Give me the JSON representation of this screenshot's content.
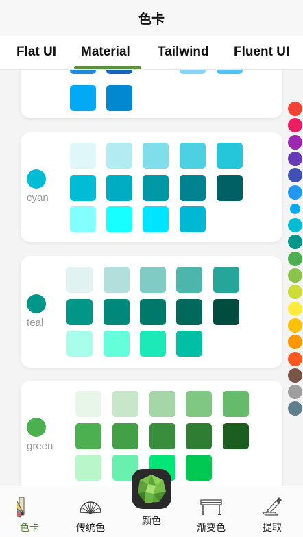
{
  "title": "色卡",
  "tabs": [
    {
      "label": "Flat UI",
      "active": false
    },
    {
      "label": "Material",
      "active": true
    },
    {
      "label": "Tailwind",
      "active": false
    },
    {
      "label": "Fluent UI",
      "active": false
    }
  ],
  "accent": "#5c8f3f",
  "cards": [
    {
      "name": "",
      "dot": "",
      "rows": [
        [
          "#1e88e5",
          "#1565c0",
          "",
          "#81d4fa",
          "#4fc3f7"
        ],
        [
          "#03a9f4",
          "#0288d1"
        ]
      ]
    },
    {
      "name": "cyan",
      "dot": "#00bcd4",
      "rows": [
        [
          "#e0f7fa",
          "#b2ebf2",
          "#80deea",
          "#4dd0e1",
          "#26c6da"
        ],
        [
          "#00bcd4",
          "#00acc1",
          "#0097a7",
          "#00838f",
          "#006064"
        ],
        [
          "#84ffff",
          "#18ffff",
          "#00e5ff",
          "#00b8d4"
        ]
      ]
    },
    {
      "name": "teal",
      "dot": "#009688",
      "rows": [
        [
          "#e0f2f1",
          "#b2dfdb",
          "#80cbc4",
          "#4db6ac",
          "#26a69a"
        ],
        [
          "#009688",
          "#00897b",
          "#00796b",
          "#00695c",
          "#004d40"
        ],
        [
          "#a7ffeb",
          "#64ffda",
          "#1de9b6",
          "#00bfa5"
        ]
      ]
    },
    {
      "name": "green",
      "dot": "#4caf50",
      "rows": [
        [
          "#e8f5e9",
          "#c8e6c9",
          "#a5d6a7",
          "#81c784",
          "#66bb6a"
        ],
        [
          "#4caf50",
          "#43a047",
          "#388e3c",
          "#2e7d32",
          "#1b5e20"
        ],
        [
          "#b9f6ca",
          "#69f0ae",
          "#00e676",
          "#00c853"
        ]
      ]
    }
  ],
  "index_colors": [
    "#f44336",
    "#e91e63",
    "#9c27b0",
    "#673ab7",
    "#3f51b5",
    "#2196f3",
    "#03a9f4",
    "#00bcd4",
    "#009688",
    "#4caf50",
    "#8bc34a",
    "#cddc39",
    "#ffeb3b",
    "#ffc107",
    "#ff9800",
    "#ff5722",
    "#795548",
    "#9e9e9e",
    "#607d8b"
  ],
  "bottom_nav": [
    {
      "label": "色卡",
      "icon": "swatch-fan-icon",
      "active": true
    },
    {
      "label": "传统色",
      "icon": "folding-fan-icon",
      "active": false
    },
    {
      "label": "颜色",
      "icon": "green-gem-icon",
      "active": false
    },
    {
      "label": "渐变色",
      "icon": "gradient-bar-icon",
      "active": false
    },
    {
      "label": "提取",
      "icon": "color-picker-icon",
      "active": false
    }
  ]
}
